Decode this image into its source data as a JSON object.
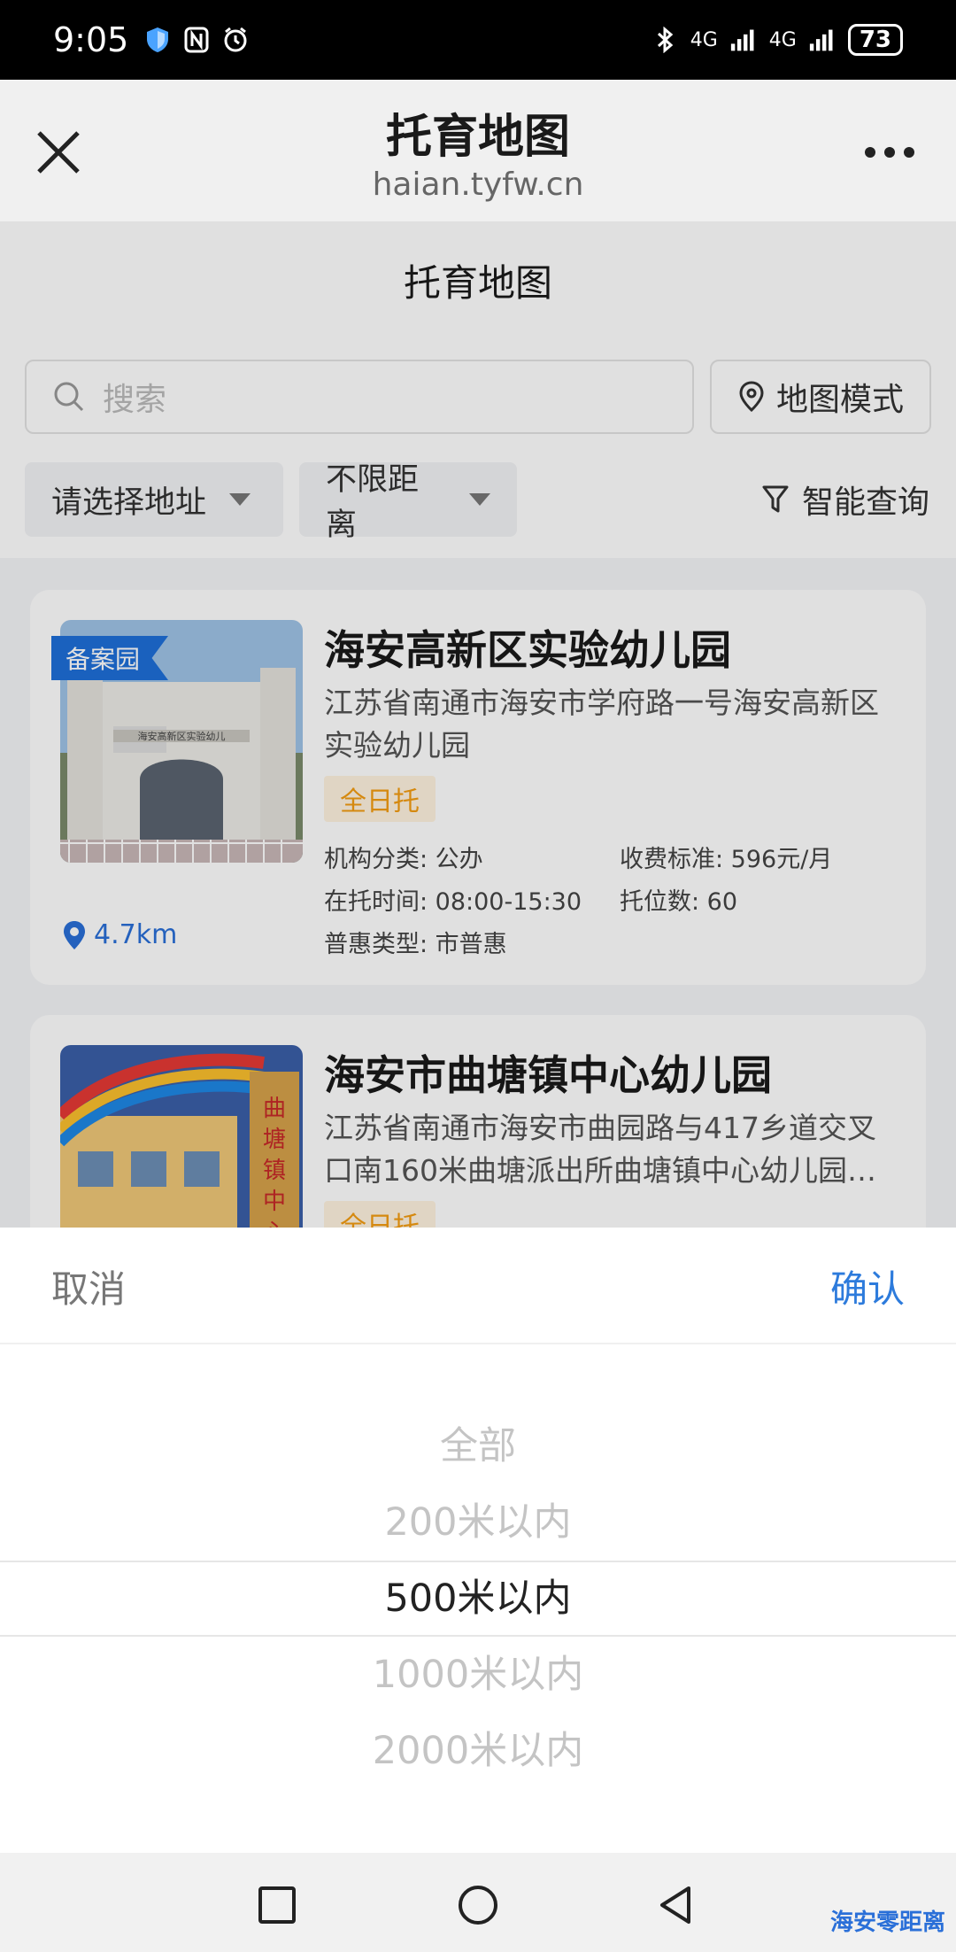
{
  "status_bar": {
    "time": "9:05",
    "battery": "73",
    "signal_label_1": "4G",
    "signal_label_2": "4G"
  },
  "title_bar": {
    "title": "托育地图",
    "url": "haian.tyfw.cn"
  },
  "page": {
    "title": "托育地图",
    "search_placeholder": "搜索",
    "map_mode": "地图模式",
    "address_filter": "请选择地址",
    "distance_filter": "不限距离",
    "smart_query": "智能查询"
  },
  "cards": [
    {
      "badge": "备案园",
      "name": "海安高新区实验幼儿园",
      "address": "江苏省南通市海安市学府路一号海安高新区实验幼儿园",
      "tag": "全日托",
      "category": "机构分类: 公办",
      "fee": "收费标准: 596元/月",
      "hours": "在托时间: 08:00-15:30",
      "slots": "托位数: 60",
      "benefit": "普惠类型: 市普惠",
      "distance": "4.7km"
    },
    {
      "name": "海安市曲塘镇中心幼儿园",
      "address": "江苏省南通市海安市曲园路与417乡道交叉口南160米曲塘派出所曲塘镇中心幼儿园…",
      "tag": "全日托"
    }
  ],
  "picker": {
    "cancel": "取消",
    "confirm": "确认",
    "options": [
      "全部",
      "200米以内",
      "500米以内",
      "1000米以内",
      "2000米以内"
    ],
    "selected": "500米以内"
  },
  "watermark": "海安零距离",
  "colors": {
    "accent": "#2d7bdc",
    "badge": "#1e6fd9",
    "tag_text": "#f39c12",
    "tag_bg": "#fff3e0"
  }
}
